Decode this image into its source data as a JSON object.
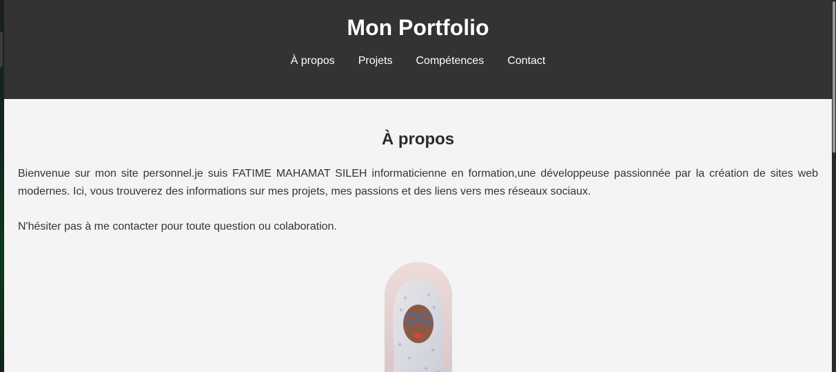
{
  "header": {
    "title": "Mon Portfolio",
    "nav": [
      {
        "label": "À propos"
      },
      {
        "label": "Projets"
      },
      {
        "label": "Compétences"
      },
      {
        "label": "Contact"
      }
    ]
  },
  "about": {
    "heading": "À propos",
    "paragraph1": "Bienvenue sur mon site personnel.je suis FATIME MAHAMAT SILEH informaticienne en formation,une développeuse passionnée par la création de sites web modernes. Ici, vous trouverez des informations sur mes projets, mes passions et des liens vers mes réseaux sociaux.",
    "paragraph2": "N'hésiter pas à me contacter pour toute question ou colaboration."
  },
  "colors": {
    "header_bg": "#333333",
    "page_bg": "#f4f4f4",
    "text": "#333333"
  }
}
